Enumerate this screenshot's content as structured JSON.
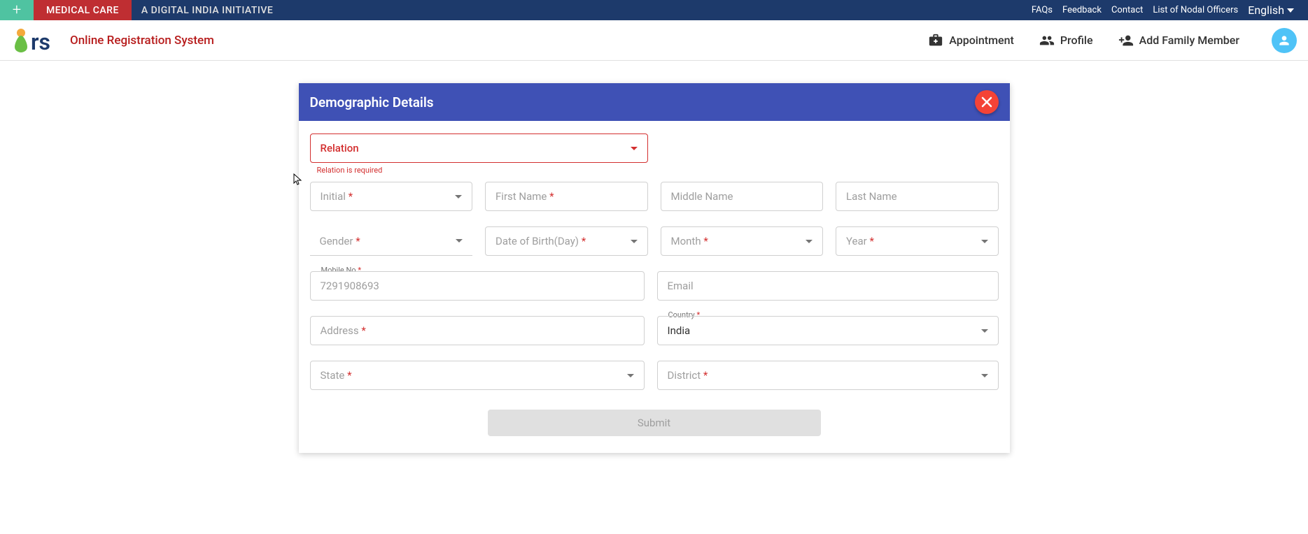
{
  "topbar": {
    "medical_care": "MEDICAL CARE",
    "initiative": "A DIGITAL INDIA INITIATIVE",
    "links": {
      "faqs": "FAQs",
      "feedback": "Feedback",
      "contact": "Contact",
      "nodal": "List of Nodal Officers",
      "lang": "English"
    }
  },
  "navbar": {
    "ors_title": "Online Registration System",
    "appointment": "Appointment",
    "profile": "Profile",
    "add_family": "Add Family Member"
  },
  "modal": {
    "title": "Demographic Details",
    "relation": {
      "label": "Relation",
      "error": "Relation is required"
    },
    "initial": {
      "label": "Initial"
    },
    "first_name": {
      "label": "First Name"
    },
    "middle_name": {
      "label": "Middle Name"
    },
    "last_name": {
      "label": "Last Name"
    },
    "gender": {
      "label": "Gender"
    },
    "dob_day": {
      "label": "Date of Birth(Day)"
    },
    "month": {
      "label": "Month"
    },
    "year": {
      "label": "Year"
    },
    "mobile": {
      "label": "Mobile No",
      "value": "7291908693"
    },
    "email": {
      "label": "Email"
    },
    "address": {
      "label": "Address"
    },
    "country": {
      "label": "Country",
      "value": "India"
    },
    "state": {
      "label": "State"
    },
    "district": {
      "label": "District"
    },
    "submit": "Submit"
  }
}
